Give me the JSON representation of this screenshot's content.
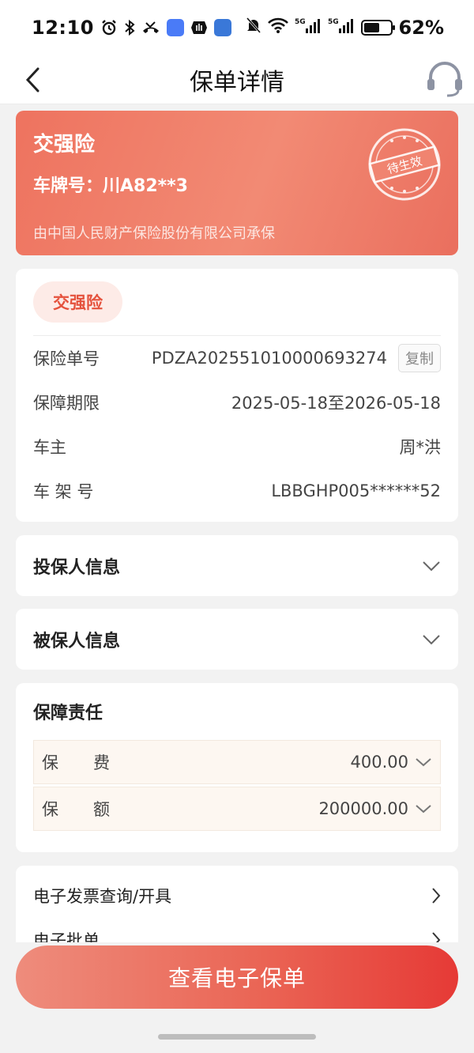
{
  "status_bar": {
    "time": "12:10",
    "battery_percent": "62%",
    "battery_level": 0.62,
    "signal_labels": [
      "5G",
      "5G"
    ]
  },
  "nav": {
    "title": "保单详情",
    "back_icon": "chevron-left-icon",
    "service_icon": "headset-icon"
  },
  "banner": {
    "title": "交强险",
    "plate_label": "车牌号：",
    "plate_value": "川A82**3",
    "company": "由中国人民财产保险股份有限公司承保",
    "stamp_text": "待生效",
    "colors": {
      "start": "#ee735f",
      "end": "#ea6f5e"
    }
  },
  "policy_info": {
    "tag": "交强险",
    "rows": [
      {
        "label": "保险单号",
        "value": "PDZA20255101000069327 4",
        "has_copy": true
      },
      {
        "label": "保障期限",
        "value": "2025-05-18至2026-05-18"
      },
      {
        "label": "车主",
        "value": "周*洪"
      },
      {
        "label": "车 架 号",
        "value": "LBBGHP005******52"
      }
    ],
    "copy_label": "复制"
  },
  "sections": {
    "policyholder": "投保人信息",
    "insured": "被保人信息"
  },
  "coverage": {
    "title": "保障责任",
    "rows": [
      {
        "label": "保费",
        "value": "400.00"
      },
      {
        "label": "保额",
        "value": "200000.00"
      }
    ]
  },
  "links": [
    {
      "label": "电子发票查询/开具"
    },
    {
      "label": "电子批单"
    }
  ],
  "cta": {
    "label": "查看电子保单"
  },
  "colors": {
    "accent": "#e5523d",
    "tag_bg": "#fdebe7",
    "coverage_bg": "#fdf7f1"
  }
}
